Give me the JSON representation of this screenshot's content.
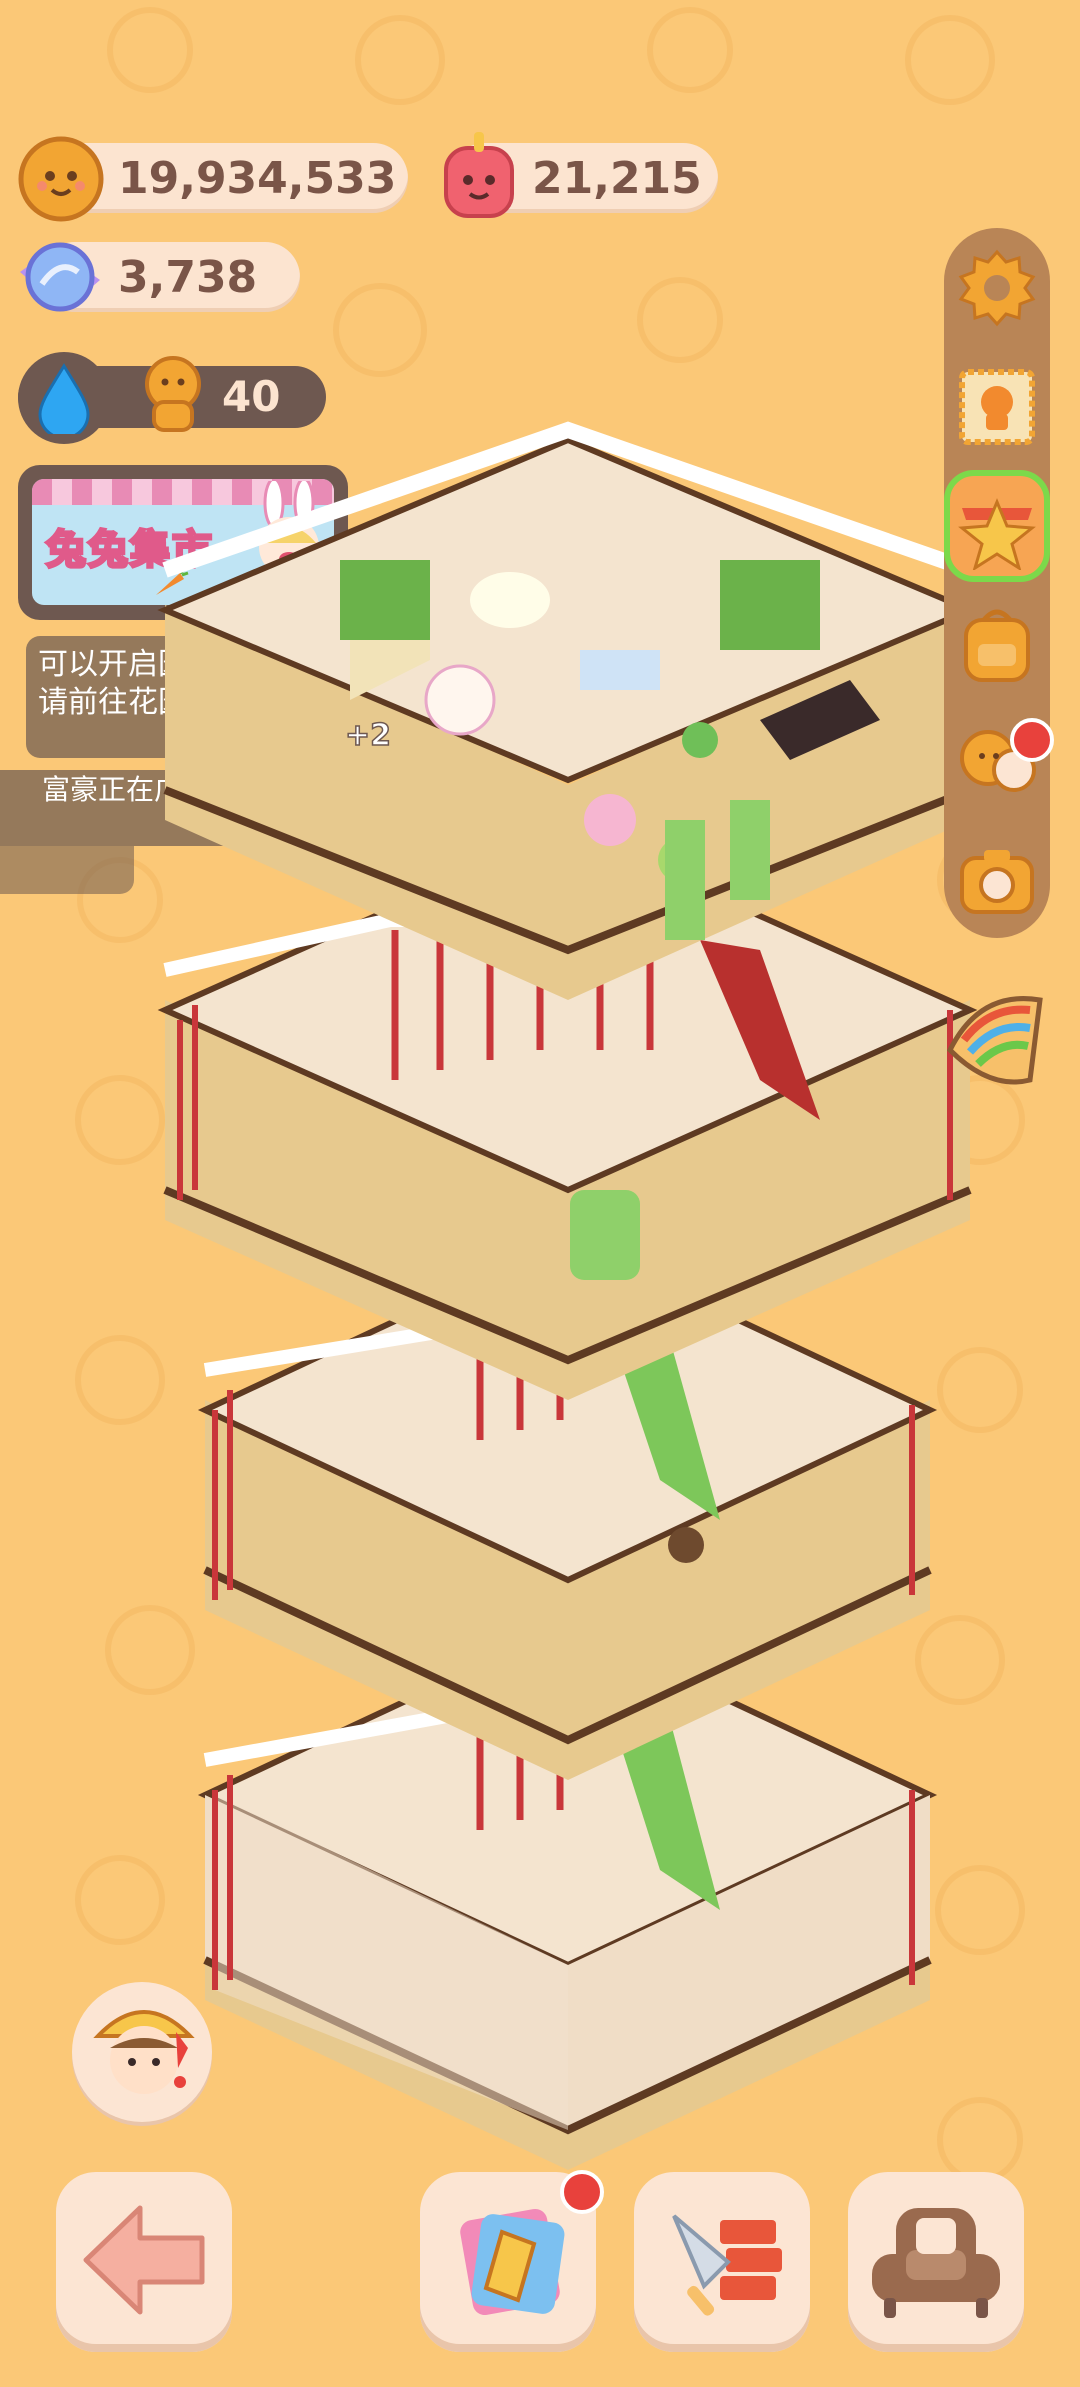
{
  "resources": {
    "coins": "19,934,533",
    "gems": "21,215",
    "candy": "3,738",
    "visitors": "40"
  },
  "banner": {
    "title": "兔兔集市"
  },
  "messages": {
    "garden_party": "可以开启园游会了！请前往花园吧",
    "rich_visitor": "富豪正在广场任性撒钱"
  },
  "floating_text": {
    "plus": "+2"
  },
  "side_menu": {
    "icons": [
      "gear-icon",
      "stamp-card-icon",
      "star-shop-icon",
      "backpack-icon",
      "friends-icon",
      "camera-icon"
    ],
    "selected": "star-shop-icon"
  },
  "bottom_bar": {
    "icons": [
      "back-arrow-icon",
      "paint-card-icon",
      "trowel-brick-icon",
      "sofa-icon"
    ]
  },
  "colors": {
    "background": "#FBC877",
    "pill": "#FCE4D0",
    "text": "#7A5548",
    "accent_green": "#7CD94A",
    "notification_red": "#E8413C"
  }
}
